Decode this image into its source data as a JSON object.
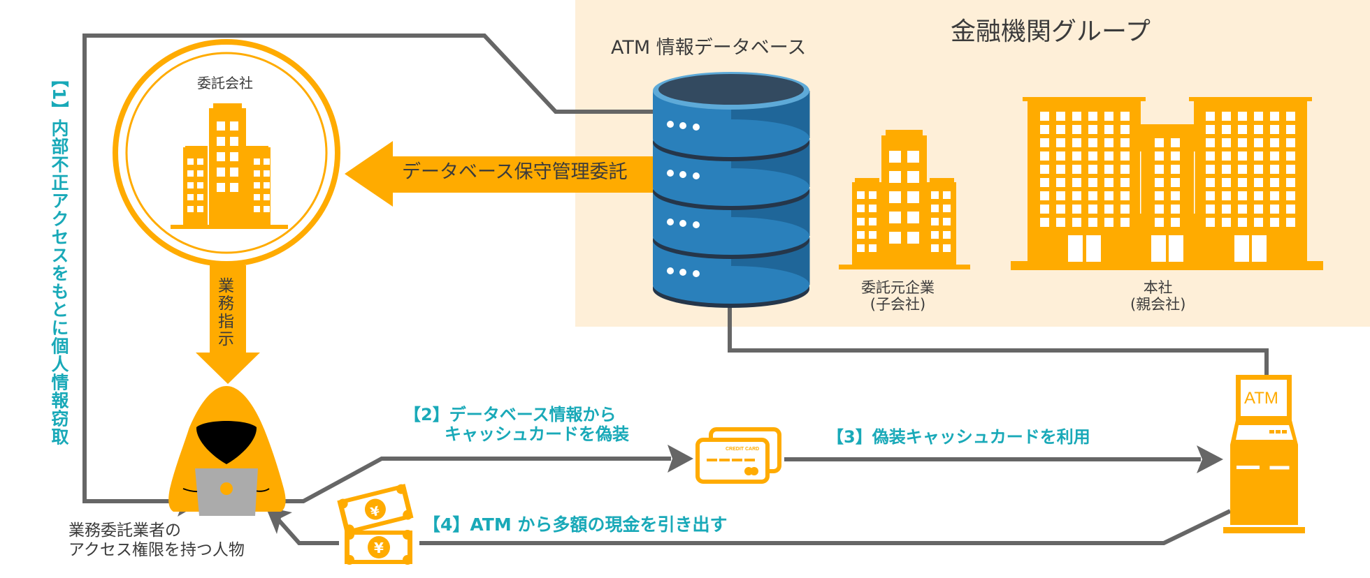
{
  "colors": {
    "orange": "#ffab00",
    "panel_bg": "#feefd8",
    "teal": "#19a9b8",
    "line_gray": "#666666",
    "text_dark": "#3b3b3b",
    "db_blue": "#2a7bb4",
    "db_blue_dark": "#1f6699",
    "db_top": "#334a60"
  },
  "group_panel": {
    "title": "金融機関グループ",
    "database_title": "ATM 情報データベース",
    "subsidiary": {
      "line1": "委託元企業",
      "line2": "(子会社)"
    },
    "headquarters": {
      "line1": "本社",
      "line2": "(親会社)"
    }
  },
  "contractor": {
    "label": "委託会社",
    "maintenance_arrow_label": "データベース保守管理委託",
    "instruction_arrow_label": "業務指示"
  },
  "person": {
    "line1": "業務委託業者の",
    "line2": "アクセス権限を持つ人物"
  },
  "steps": {
    "step1": "【1】内部不正アクセスをもとに個人情報窃取",
    "step2_line1": "【2】データベース情報から",
    "step2_line2": "キャッシュカードを偽装",
    "step3": "【3】偽装キャッシュカードを利用",
    "step4": "【4】ATM から多額の現金を引き出す"
  },
  "icons": {
    "card_text": "CREDIT CARD",
    "atm_screen": "ATM",
    "currency_symbol": "¥"
  }
}
